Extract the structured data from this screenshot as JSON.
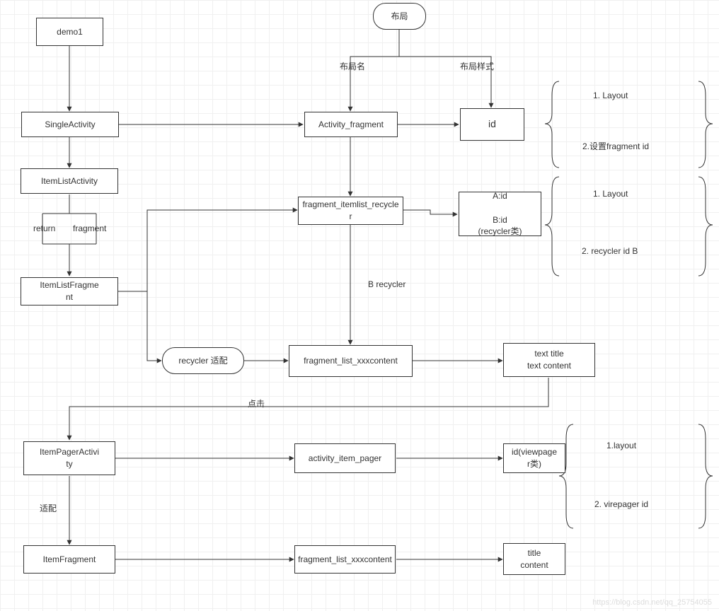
{
  "nodes": {
    "demo1": "demo1",
    "layout_root": "布局",
    "single_activity": "SingleActivity",
    "activity_fragment": "Activity_fragment",
    "id": "id",
    "item_list_activity": "ItemListActivity",
    "fragment_itemlist_recycler": "fragment_itemlist_recycle\nr",
    "aid_bid": "A:id\n\nB:id\n(recycler类)",
    "item_list_fragment": "ItemListFragme\nnt",
    "recycler_adapter": "recycler 适配",
    "fragment_list_xxxcontent_1": "fragment_list_xxxcontent",
    "text_title_content": "text title\ntext content",
    "item_pager_activity": "ItemPagerActivi\nty",
    "activity_item_pager": "activity_item_pager",
    "id_viewpager": "id(viewpage\nr类)",
    "item_fragment": "ItemFragment",
    "fragment_list_xxxcontent_2": "fragment_list_xxxcontent",
    "title_content": "title\ncontent"
  },
  "edge_labels": {
    "layout_name": "布局名",
    "layout_style": "布局样式",
    "return": "return",
    "fragment": "fragment",
    "b_recycler": "B recycler",
    "click": "点击",
    "adapt": "适配"
  },
  "brace_labels": {
    "b1a": "1. Layout",
    "b1b": "2.设置fragment id",
    "b2a": "1. Layout",
    "b2b": "2. recycler id B",
    "b3a": "1.layout",
    "b3b": "2. virepager id"
  },
  "watermark": "https://blog.csdn.net/qq_25754055"
}
